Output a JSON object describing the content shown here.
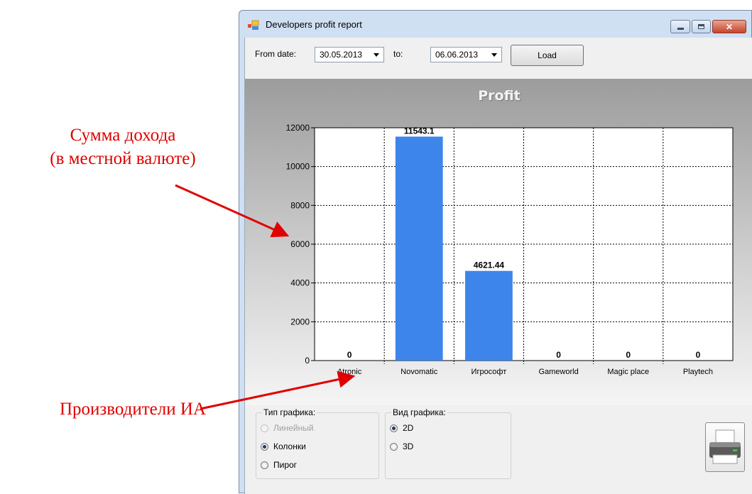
{
  "annotations": {
    "y_axis_note_line1": "Сумма дохода",
    "y_axis_note_line2": "(в местной валюте)",
    "x_axis_note": "Производители ИА"
  },
  "window": {
    "title": "Developers profit report",
    "icon": "app-icon"
  },
  "toolbar": {
    "from_label": "From date:",
    "from_value": "30.05.2013",
    "to_label": "to:",
    "to_value": "06.06.2013",
    "load_label": "Load"
  },
  "chart_data": {
    "type": "bar",
    "title": "Profit",
    "categories": [
      "Atronic",
      "Novomatic",
      "Игрософт",
      "Gameworld",
      "Magic place",
      "Playtech"
    ],
    "values": [
      0,
      11543.1,
      4621.44,
      0,
      0,
      0
    ],
    "value_labels": [
      "0",
      "11543.1",
      "4621.44",
      "0",
      "0",
      "0"
    ],
    "ylim": [
      0,
      12000
    ],
    "yticks": [
      "0",
      "2000",
      "4000",
      "6000",
      "8000",
      "10000",
      "12000"
    ],
    "bar_color": "#3d85ea",
    "grid": true
  },
  "chart_type_group": {
    "title": "Тип графика:",
    "options": [
      {
        "label": "Линейный",
        "selected": false,
        "disabled": true
      },
      {
        "label": "Колонки",
        "selected": true,
        "disabled": false
      },
      {
        "label": "Пирог",
        "selected": false,
        "disabled": false
      }
    ]
  },
  "chart_view_group": {
    "title": "Вид графика:",
    "options": [
      {
        "label": "2D",
        "selected": true
      },
      {
        "label": "3D",
        "selected": false
      }
    ]
  },
  "print_button": {
    "icon": "printer-icon"
  }
}
